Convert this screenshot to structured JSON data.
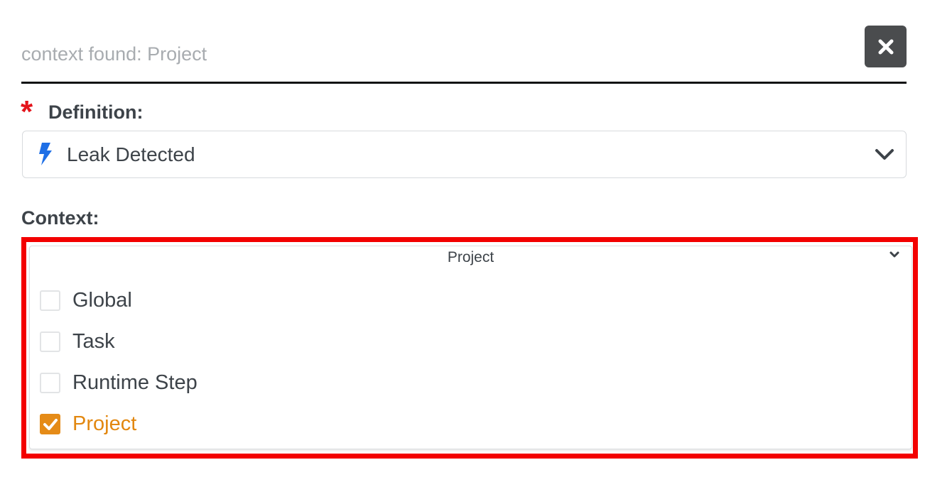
{
  "search": {
    "placeholder": "context found: Project",
    "value": ""
  },
  "close_icon": "close-icon",
  "definition": {
    "required_marker": "*",
    "label": "Definition:",
    "value": "Leak Detected",
    "icon": "bolt-icon",
    "chevron_icon": "chevron-down-icon"
  },
  "context": {
    "label": "Context:",
    "selected_value": "Project",
    "options": [
      {
        "label": "Global",
        "checked": false
      },
      {
        "label": "Task",
        "checked": false
      },
      {
        "label": "Runtime Step",
        "checked": false
      },
      {
        "label": "Project",
        "checked": true
      }
    ]
  },
  "colors": {
    "required": "#e4141b",
    "accent": "#e58b17",
    "bolt": "#1e6fe6",
    "highlight": "#f30000",
    "close_button": "#4a4c4e"
  }
}
